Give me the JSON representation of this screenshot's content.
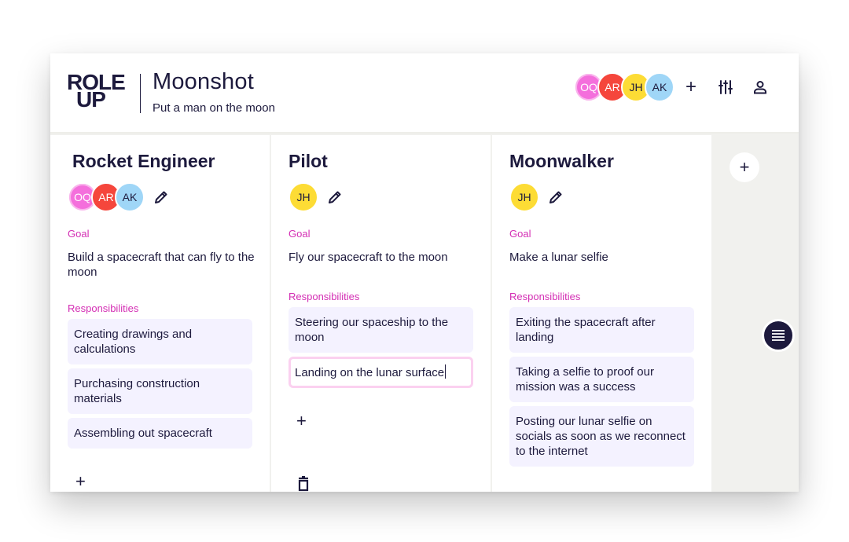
{
  "app": {
    "logo_line1": "ROLE",
    "logo_line2": "UP",
    "project_title": "Moonshot",
    "project_subtitle": "Put a man on the moon"
  },
  "header": {
    "members": [
      {
        "initials": "OQ",
        "color": "#f46fdc"
      },
      {
        "initials": "AR",
        "color": "#f5463c"
      },
      {
        "initials": "JH",
        "color": "#fddc35"
      },
      {
        "initials": "AK",
        "color": "#9fd6f7"
      }
    ],
    "add_member_label": "+",
    "icons": [
      "add-member-icon",
      "sliders-icon",
      "user-icon"
    ]
  },
  "labels": {
    "goal": "Goal",
    "responsibilities": "Responsibilities",
    "add": "+"
  },
  "roles": [
    {
      "title": "Rocket Engineer",
      "members": [
        "OQ",
        "AR",
        "AK"
      ],
      "goal": "Build a spacecraft that can fly to the moon",
      "responsibilities": [
        "Creating drawings and calculations",
        "Purchasing construction materials",
        "Assembling out spacecraft"
      ]
    },
    {
      "title": "Pilot",
      "members": [
        "JH"
      ],
      "goal": "Fly our spacecraft to the moon",
      "responsibilities": [
        "Steering our spaceship to the moon",
        "Landing on the lunar surface"
      ],
      "editing_index": 1
    },
    {
      "title": "Moonwalker",
      "members": [
        "JH"
      ],
      "goal": "Make a lunar selfie",
      "responsibilities": [
        "Exiting the spacecraft after landing",
        "Taking a selfie to proof our mission was a success",
        "Posting our lunar selfie on socials as soon as we reconnect to the internet"
      ]
    }
  ],
  "sidebar": {
    "add_role_label": "+",
    "menu_icon": "menu-icon"
  }
}
